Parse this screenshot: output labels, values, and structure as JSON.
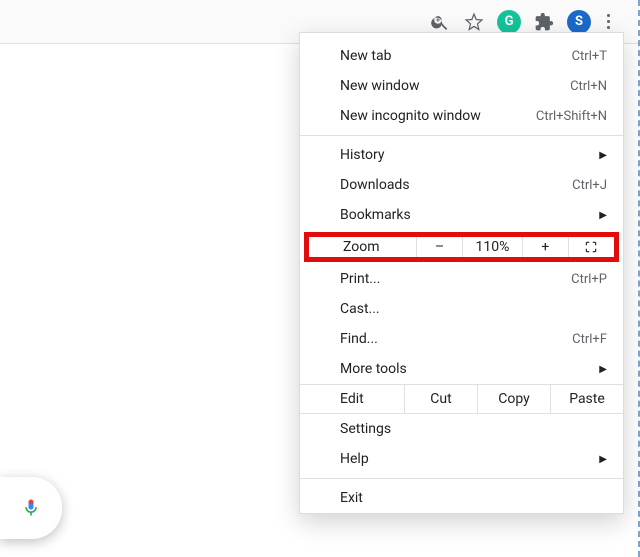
{
  "toolbar": {
    "zoom_icon": "zoom-icon",
    "star_icon": "star-icon",
    "g_label": "G",
    "ext_icon": "extensions-icon",
    "s_label": "S",
    "menu_icon": "three-dots-icon"
  },
  "menu": {
    "new_tab": "New tab",
    "new_tab_sc": "Ctrl+T",
    "new_window": "New window",
    "new_window_sc": "Ctrl+N",
    "new_incognito": "New incognito window",
    "new_incognito_sc": "Ctrl+Shift+N",
    "history": "History",
    "downloads": "Downloads",
    "downloads_sc": "Ctrl+J",
    "bookmarks": "Bookmarks",
    "zoom": "Zoom",
    "zoom_minus": "–",
    "zoom_val": "110%",
    "zoom_plus": "+",
    "print": "Print...",
    "print_sc": "Ctrl+P",
    "cast": "Cast...",
    "find": "Find...",
    "find_sc": "Ctrl+F",
    "more_tools": "More tools",
    "edit": "Edit",
    "cut": "Cut",
    "copy": "Copy",
    "paste": "Paste",
    "settings": "Settings",
    "help": "Help",
    "exit": "Exit",
    "arrow": "▶"
  }
}
